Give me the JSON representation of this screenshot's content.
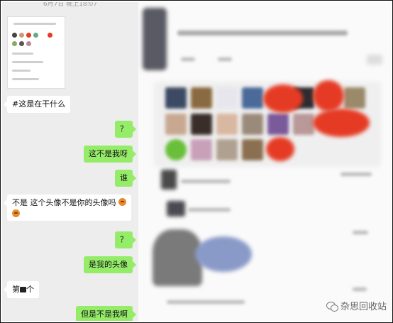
{
  "chat": {
    "timestamp": "6月7日 晚上18:07",
    "messages": [
      {
        "dir": "in",
        "text": "#这是在干什么"
      },
      {
        "dir": "out",
        "text": "？"
      },
      {
        "dir": "out",
        "text": "这不是我呀"
      },
      {
        "dir": "out",
        "text": "谁"
      },
      {
        "dir": "in",
        "text": "不是 这个头像不是你的头像吗"
      },
      {
        "dir": "out",
        "text": "？"
      },
      {
        "dir": "out",
        "text": "是我的头像"
      },
      {
        "dir": "in",
        "text_before": "第",
        "text_after": "个"
      },
      {
        "dir": "out",
        "text": "但是不是我啊"
      }
    ]
  },
  "watermark": {
    "label": "杂思回收站",
    "icon": "wechat-icon"
  },
  "colors": {
    "outgoing_bubble": "#95ec69",
    "incoming_bubble": "#ffffff",
    "chat_bg": "#ededed",
    "redaction": "#e53b24"
  }
}
